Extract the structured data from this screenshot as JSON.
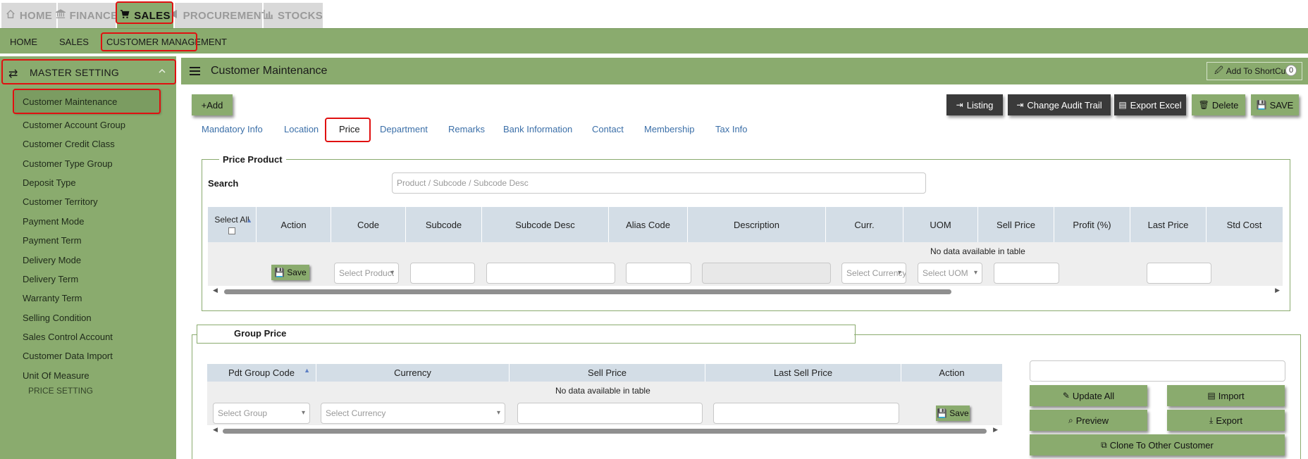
{
  "modules": [
    {
      "label": "HOME",
      "icon": "home-icon"
    },
    {
      "label": "FINANCE",
      "icon": "bank-icon"
    },
    {
      "label": "SALES",
      "icon": "cart-icon"
    },
    {
      "label": "PROCUREMENT",
      "icon": "megaphone-icon"
    },
    {
      "label": "STOCKS",
      "icon": "bar-chart-icon"
    }
  ],
  "subnav": [
    "HOME",
    "SALES",
    "CUSTOMER MANAGEMENT"
  ],
  "sidebar": {
    "section_title": "MASTER SETTING",
    "items": [
      "Customer Maintenance",
      "Customer Account Group",
      "Customer Credit Class",
      "Customer Type Group",
      "Deposit Type",
      "Customer Territory",
      "Payment Mode",
      "Payment Term",
      "Delivery Mode",
      "Delivery Term",
      "Warranty Term",
      "Selling Condition",
      "Sales Control Account",
      "Customer Data Import",
      "Unit Of Measure"
    ],
    "next_section": "PRICE SETTING"
  },
  "header": {
    "title": "Customer Maintenance",
    "shortcut_label": "Add To ShortCut",
    "shortcut_count": "0"
  },
  "toolbar": {
    "add": "+Add",
    "listing": "Listing",
    "audit": "Change Audit Trail",
    "export_excel": "Export Excel",
    "delete": "Delete",
    "save": "SAVE"
  },
  "tabs": [
    "Mandatory Info",
    "Location",
    "Price",
    "Department",
    "Remarks",
    "Bank Information",
    "Contact",
    "Membership",
    "Tax Info"
  ],
  "price_product": {
    "legend": "Price Product",
    "search_label": "Search",
    "search_placeholder": "Product / Subcode / Subcode Desc",
    "select_all": "Select All",
    "columns": [
      "Action",
      "Code",
      "Subcode",
      "Subcode Desc",
      "Alias Code",
      "Description",
      "Curr.",
      "UOM",
      "Sell Price",
      "Profit (%)",
      "Last Price",
      "Std Cost"
    ],
    "no_data": "No data available in table",
    "row_save": "Save",
    "select_product": "Select Product",
    "select_currency": "Select Currency",
    "select_uom": "Select UOM"
  },
  "group_price": {
    "legend": "Group Price",
    "columns": [
      "Pdt Group Code",
      "Currency",
      "Sell Price",
      "Last Sell Price",
      "Action"
    ],
    "no_data": "No data available in table",
    "select_group": "Select Group",
    "select_currency": "Select Currency",
    "row_save": "Save",
    "buttons": {
      "update_all": "Update All",
      "import": "Import",
      "preview": "Preview",
      "export": "Export",
      "clone": "Clone To Other Customer"
    }
  },
  "colors": {
    "brand_green": "#8aab6e",
    "highlight_red": "#e01010",
    "table_header": "#d3dde6",
    "link_blue": "#3b6fa8"
  }
}
